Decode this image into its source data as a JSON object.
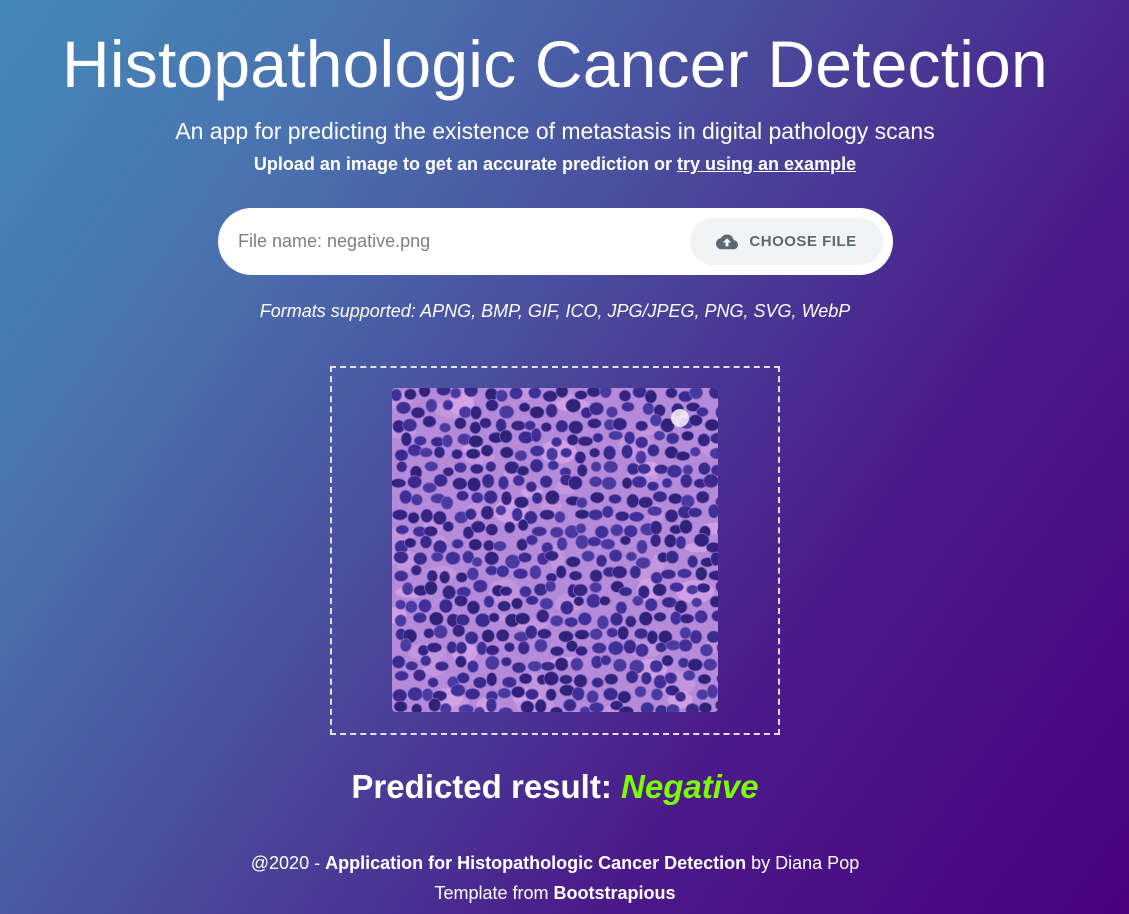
{
  "header": {
    "title": "Histopathologic Cancer Detection",
    "subtitle": "An app for predicting the existence of metastasis in digital pathology scans",
    "upload_prompt": "Upload an image to get an accurate prediction or",
    "example_link": "try using an example"
  },
  "upload": {
    "file_name": "File name: negative.png",
    "choose_label": "CHOOSE FILE",
    "icon": "cloud-upload-icon",
    "formats": "Formats supported: APNG, BMP, GIF, ICO, JPG/JPEG, PNG, SVG, WebP"
  },
  "result": {
    "label": "Predicted result:",
    "value": "Negative",
    "value_color": "#7cfc00"
  },
  "footer": {
    "copyright": "@2020 -",
    "app_name": "Application for Histopathologic Cancer Detection",
    "by": "by Diana Pop",
    "template_prefix": "Template from",
    "template_name": "Bootstrapious"
  }
}
